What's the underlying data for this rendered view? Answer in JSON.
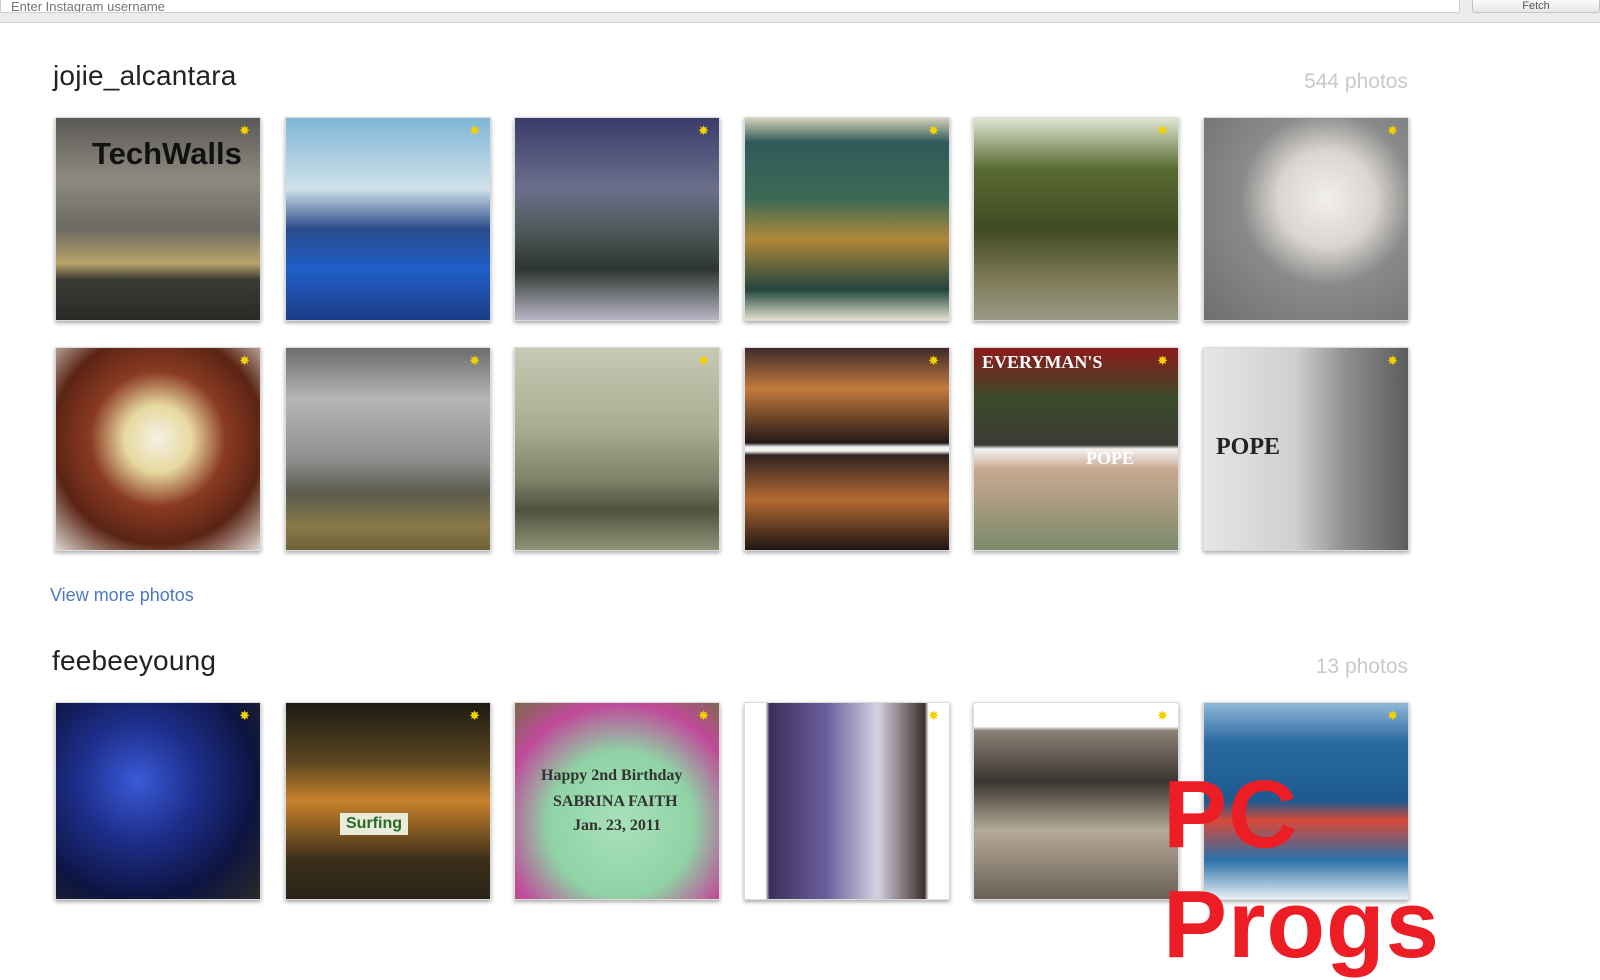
{
  "search": {
    "placeholder": "Enter Instagram username",
    "button_label": "Fetch"
  },
  "sections": [
    {
      "username": "jojie_alcantara",
      "count": "544 photos",
      "more_link": "View more photos",
      "photos": [
        {
          "overlay": "TechWalls"
        },
        {
          "overlay": ""
        },
        {
          "overlay": ""
        },
        {
          "overlay": ""
        },
        {
          "overlay": ""
        },
        {
          "overlay": ""
        },
        {
          "overlay": ""
        },
        {
          "overlay": ""
        },
        {
          "overlay": ""
        },
        {
          "overlay": ""
        },
        {
          "overlay": "EVERYMAN'S",
          "overlay2": "POPE"
        },
        {
          "overlay": "POPE"
        }
      ]
    },
    {
      "username": "feebeeyoung",
      "count": "13 photos",
      "photos": [
        {
          "overlay": ""
        },
        {
          "overlay": "Surfing"
        },
        {
          "overlay": "Happy 2nd Birthday",
          "overlay2": "SABRINA FAITH",
          "overlay3": "Jan. 23, 2011"
        },
        {
          "overlay": ""
        },
        {
          "overlay": ""
        },
        {
          "overlay": ""
        }
      ]
    }
  ],
  "star_glyph": "✸",
  "watermark": "PC Progs",
  "colors": {
    "link": "#4a78c2",
    "count": "#c9c9c9",
    "star": "#f2d100",
    "watermark": "#ec1d25"
  }
}
